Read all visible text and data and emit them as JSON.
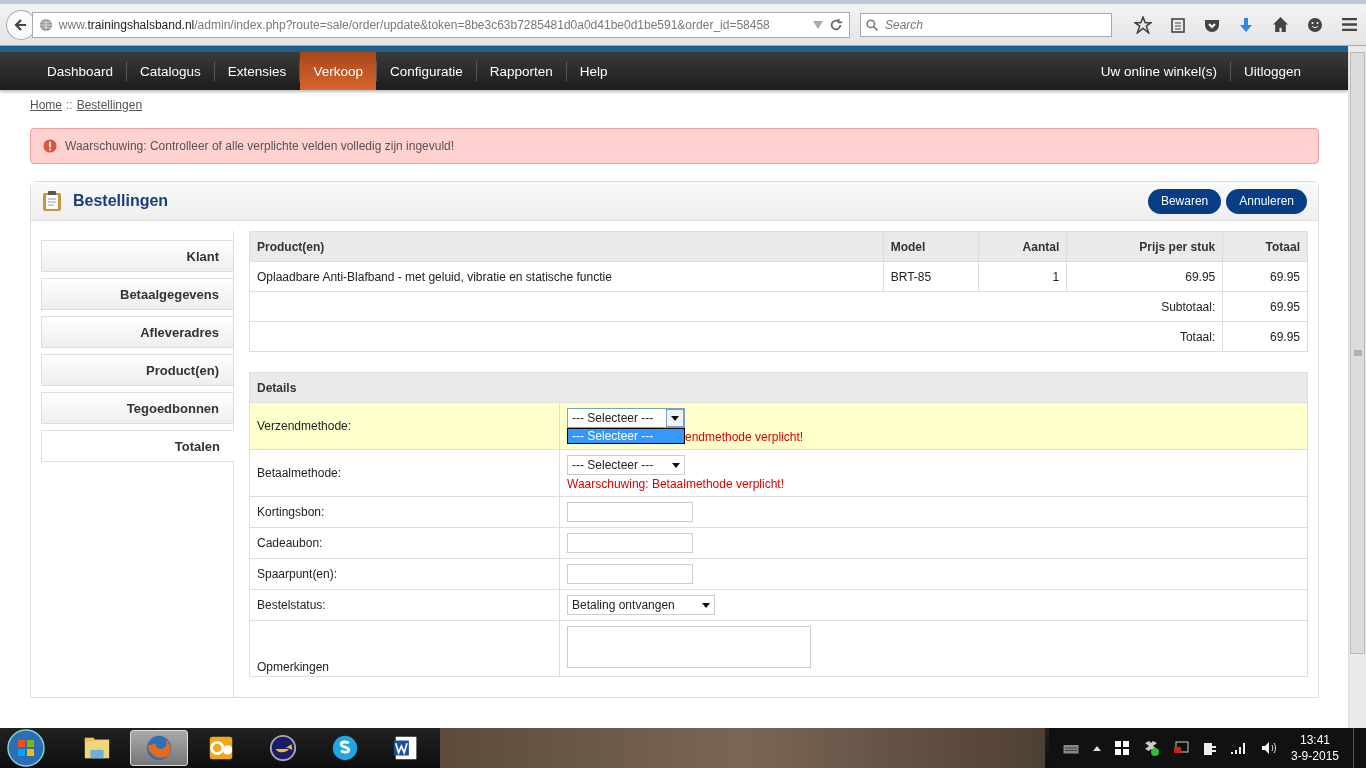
{
  "browser": {
    "url": "www.**trainingshalsband.nl**/admin/index.php?route=sale/order/update&token=8be3c63b7285481d0a0d41be0d1be591&order_id=58458",
    "search_placeholder": "Search"
  },
  "nav": {
    "items": [
      {
        "label": "Dashboard",
        "selected": false
      },
      {
        "label": "Catalogus",
        "selected": false
      },
      {
        "label": "Extensies",
        "selected": false
      },
      {
        "label": "Verkoop",
        "selected": true
      },
      {
        "label": "Configuratie",
        "selected": false
      },
      {
        "label": "Rapporten",
        "selected": false
      },
      {
        "label": "Help",
        "selected": false
      }
    ],
    "right": [
      "Uw online winkel(s)",
      "Uitloggen"
    ]
  },
  "breadcrumb": [
    "Home",
    "Bestellingen"
  ],
  "breadcrumb_separator": "::",
  "alert": "Waarschuwing: Controlleer of alle verplichte velden volledig zijn ingevuld!",
  "panel": {
    "title": "Bestellingen",
    "buttons": [
      "Bewaren",
      "Annuleren"
    ]
  },
  "side_tabs": [
    {
      "label": "Klant",
      "selected": false
    },
    {
      "label": "Betaalgegevens",
      "selected": false
    },
    {
      "label": "Afleveradres",
      "selected": false
    },
    {
      "label": "Product(en)",
      "selected": false
    },
    {
      "label": "Tegoedbonnen",
      "selected": false
    },
    {
      "label": "Totalen",
      "selected": true
    }
  ],
  "products": {
    "columns": [
      "Product(en)",
      "Model",
      "Aantal",
      "Prijs per stuk",
      "Totaal"
    ],
    "rows": [
      [
        "Oplaadbare Anti-Blafband - met geluid, vibratie en statische functie",
        "BRT-85",
        "1",
        "69.95",
        "69.95"
      ]
    ],
    "totals": [
      {
        "label": "Subtotaal:",
        "value": "69.95"
      },
      {
        "label": "Totaal:",
        "value": "69.95"
      }
    ]
  },
  "details": {
    "title": "Details",
    "rows": [
      {
        "kind": "select",
        "label": "Verzendmethode:",
        "value": "--- Selecteer ---",
        "focused": true,
        "open_option": "--- Selecteer ---",
        "error": "endmethode verplicht!"
      },
      {
        "kind": "select",
        "label": "Betaalmethode:",
        "value": "--- Selecteer ---",
        "focused": false,
        "error": "Waarschuwing: Betaalmethode verplicht!"
      },
      {
        "kind": "input",
        "label": "Kortingsbon:"
      },
      {
        "kind": "input",
        "label": "Cadeaubon:"
      },
      {
        "kind": "input",
        "label": "Spaarpunt(en):"
      },
      {
        "kind": "select",
        "label": "Bestelstatus:",
        "value": "Betaling ontvangen",
        "focused": false,
        "wide": true
      },
      {
        "kind": "textarea",
        "label": "Opmerkingen"
      }
    ]
  },
  "taskbar": {
    "apps": [
      {
        "kind": "folder",
        "selected": false
      },
      {
        "kind": "firefox",
        "selected": true
      },
      {
        "kind": "outlook",
        "selected": false
      },
      {
        "kind": "sync",
        "selected": false
      },
      {
        "kind": "skype",
        "selected": false
      },
      {
        "kind": "word",
        "selected": false
      }
    ],
    "time": "13:41",
    "date": "3-9-2015"
  }
}
